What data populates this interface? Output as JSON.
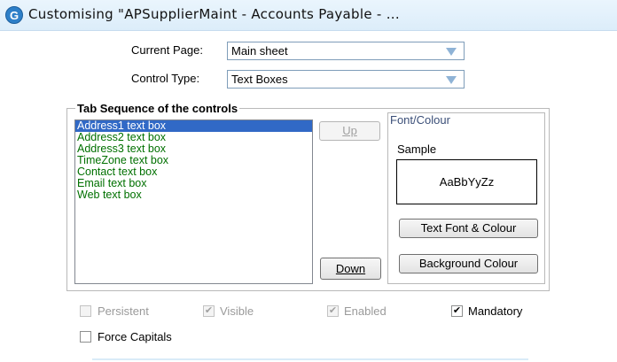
{
  "window": {
    "title": "Customising \"APSupplierMaint - Accounts Payable - ...",
    "icon_glyph": "G"
  },
  "form": {
    "current_page_label": "Current Page:",
    "current_page_value": "Main sheet",
    "control_type_label": "Control Type:",
    "control_type_value": "Text Boxes"
  },
  "tab_sequence": {
    "title": "Tab Sequence of the controls",
    "items": [
      "Address1 text box",
      "Address2 text box",
      "Address3 text box",
      "TimeZone text box",
      "Contact text box",
      "Email text box",
      "Web text box"
    ],
    "selected_index": 0,
    "up_label": "Up",
    "down_label": "Down"
  },
  "font_colour": {
    "title": "Font/Colour",
    "sample_label": "Sample",
    "sample_text": "AaBbYyZz",
    "text_font_button": "Text Font & Colour",
    "background_button": "Background Colour"
  },
  "options": {
    "persistent": {
      "label": "Persistent",
      "checked": false,
      "enabled": false
    },
    "visible": {
      "label": "Visible",
      "checked": true,
      "enabled": false
    },
    "enabled": {
      "label": "Enabled",
      "checked": true,
      "enabled": false
    },
    "mandatory": {
      "label": "Mandatory",
      "checked": true,
      "enabled": true
    },
    "force_capitals": {
      "label": "Force Capitals",
      "checked": false,
      "enabled": true
    }
  },
  "colors": {
    "list_text": "#007000",
    "selection": "#3169c6",
    "titlebar": "#dcedfa"
  }
}
